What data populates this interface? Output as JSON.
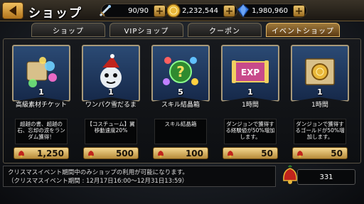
{
  "header": {
    "title": "ショップ",
    "stamina": "90/90",
    "gold": "2,232,544",
    "gems": "1,980,960",
    "plus": "+"
  },
  "tabs": [
    {
      "label": "ショップ",
      "active": false
    },
    {
      "label": "VIPショップ",
      "active": false
    },
    {
      "label": "クーポン",
      "active": false
    },
    {
      "label": "イベントショップ",
      "active": true
    }
  ],
  "items": [
    {
      "count": "1",
      "name": "高級素材チケット",
      "desc": "超越の書、超越の石、忘却の涙をランダム獲得！",
      "price": "1,250",
      "icon": "scroll-orbs-icon"
    },
    {
      "count": "1",
      "name": "ワンパク雪だるま",
      "desc": "【コスチューム】翼 移動速度20%",
      "price": "500",
      "icon": "snowman-icon"
    },
    {
      "count": "5",
      "name": "スキル結晶箱",
      "desc": "スキル結晶箱",
      "price": "100",
      "icon": "skill-crystal-icon"
    },
    {
      "count": "1",
      "name": "1時間",
      "desc": "ダンジョンで獲得する経験値が50%増加します。",
      "price": "50",
      "icon": "exp-scroll-icon"
    },
    {
      "count": "1",
      "name": "1時間",
      "desc": "ダンジョンで獲得するゴールドが50%増加します。",
      "price": "50",
      "icon": "gold-scroll-icon"
    }
  ],
  "footer": {
    "line1": "クリスマスイベント期間中のみショップの利用が可能になります。",
    "line2": "（クリスマスイベント期間 : 12月17日16:00〜12月31日13:59）"
  },
  "bell_count": "331",
  "colors": {
    "accent": "#e3b968",
    "price_bg": "#f4d890",
    "banner": "#2b4a74"
  }
}
